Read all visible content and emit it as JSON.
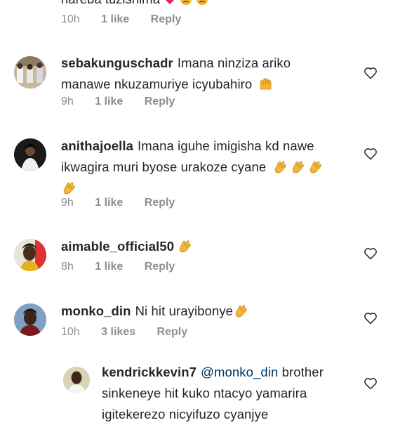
{
  "top_comment": {
    "text": "nareba tuzishima",
    "time": "10h",
    "likes": "1 like",
    "reply": "Reply"
  },
  "comments": [
    {
      "username": "sebakunguschadr",
      "text_line1": "Imana ninziza ariko",
      "text_line2": "manawe nkuzamuriye icyubahiro",
      "time": "9h",
      "likes": "1 like",
      "reply": "Reply"
    },
    {
      "username": "anithajoella",
      "text_line1": "Imana iguhe imigisha kd nawe",
      "text_line2": "ikwagira muri byose urakoze cyane",
      "time": "9h",
      "likes": "1 like",
      "reply": "Reply"
    },
    {
      "username": "aimable_official50",
      "text_line1": "",
      "time": "8h",
      "likes": "1 like",
      "reply": "Reply"
    },
    {
      "username": "monko_din",
      "text_line1": "Ni hit urayibonye",
      "time": "10h",
      "likes": "3 likes",
      "reply": "Reply"
    },
    {
      "username": "kendrickkevin7",
      "mention": "@monko_din",
      "text_line1": "brother",
      "text_line2": "sinkeneye hit kuko ntacyo yamarira",
      "text_line3": "igitekerezo nicyifuzo cyanjye"
    }
  ],
  "icons": {
    "heart": "heart-icon",
    "clap": "clapping-hands-emoji",
    "praise": "raising-hands-emoji",
    "red_heart": "red-heart-emoji",
    "sad": "sad-face-emoji"
  },
  "colors": {
    "text": "#262626",
    "meta": "#8e8e8e",
    "mention": "#003569",
    "emoji": "#f4b73a"
  }
}
